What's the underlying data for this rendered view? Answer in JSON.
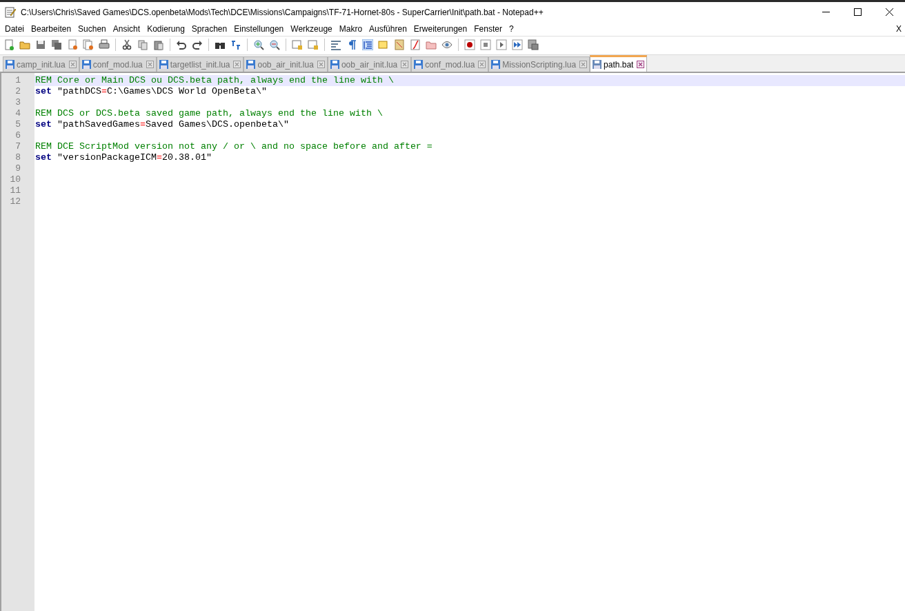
{
  "window": {
    "title": "C:\\Users\\Chris\\Saved Games\\DCS.openbeta\\Mods\\Tech\\DCE\\Missions\\Campaigns\\TF-71-Hornet-80s - SuperCarrier\\Init\\path.bat - Notepad++"
  },
  "menu": [
    "Datei",
    "Bearbeiten",
    "Suchen",
    "Ansicht",
    "Kodierung",
    "Sprachen",
    "Einstellungen",
    "Werkzeuge",
    "Makro",
    "Ausführen",
    "Erweiterungen",
    "Fenster",
    "?"
  ],
  "menu_close": "X",
  "tabs": [
    {
      "label": "camp_init.lua",
      "selected": false
    },
    {
      "label": "conf_mod.lua",
      "selected": false
    },
    {
      "label": "targetlist_init.lua",
      "selected": false
    },
    {
      "label": "oob_air_init.lua",
      "selected": false
    },
    {
      "label": "oob_air_init.lua",
      "selected": false
    },
    {
      "label": "conf_mod.lua",
      "selected": false
    },
    {
      "label": "MissionScripting.lua",
      "selected": false
    },
    {
      "label": "path.bat",
      "selected": true
    }
  ],
  "editor": {
    "lines": [
      {
        "number": "1",
        "current": true,
        "tokens": [
          {
            "kind": "comment",
            "text": "REM Core or Main DCS ou DCS.beta path, always end the line with \\"
          }
        ]
      },
      {
        "number": "2",
        "current": false,
        "tokens": [
          {
            "kind": "keyword",
            "text": "set"
          },
          {
            "kind": "text",
            "text": " \"pathDCS"
          },
          {
            "kind": "operator",
            "text": "="
          },
          {
            "kind": "text",
            "text": "C:\\Games\\DCS World OpenBeta\\\""
          }
        ]
      },
      {
        "number": "3",
        "current": false
      },
      {
        "number": "4",
        "current": false,
        "tokens": [
          {
            "kind": "comment",
            "text": "REM DCS or DCS.beta saved game path, always end the line with \\"
          }
        ]
      },
      {
        "number": "5",
        "current": false,
        "tokens": [
          {
            "kind": "keyword",
            "text": "set"
          },
          {
            "kind": "text",
            "text": " \"pathSavedGames"
          },
          {
            "kind": "operator",
            "text": "="
          },
          {
            "kind": "text",
            "text": "Saved Games\\DCS.openbeta\\\""
          }
        ]
      },
      {
        "number": "6",
        "current": false
      },
      {
        "number": "7",
        "current": false,
        "tokens": [
          {
            "kind": "comment",
            "text": "REM DCE ScriptMod version not any / or \\ and no space before and after ="
          }
        ]
      },
      {
        "number": "8",
        "current": false,
        "tokens": [
          {
            "kind": "keyword",
            "text": "set"
          },
          {
            "kind": "text",
            "text": " \"versionPackageICM"
          },
          {
            "kind": "operator",
            "text": "="
          },
          {
            "kind": "text",
            "text": "20.38.01\""
          }
        ]
      },
      {
        "number": "9",
        "current": false
      },
      {
        "number": "10",
        "current": false
      },
      {
        "number": "11",
        "current": false
      },
      {
        "number": "12",
        "current": false
      }
    ]
  }
}
